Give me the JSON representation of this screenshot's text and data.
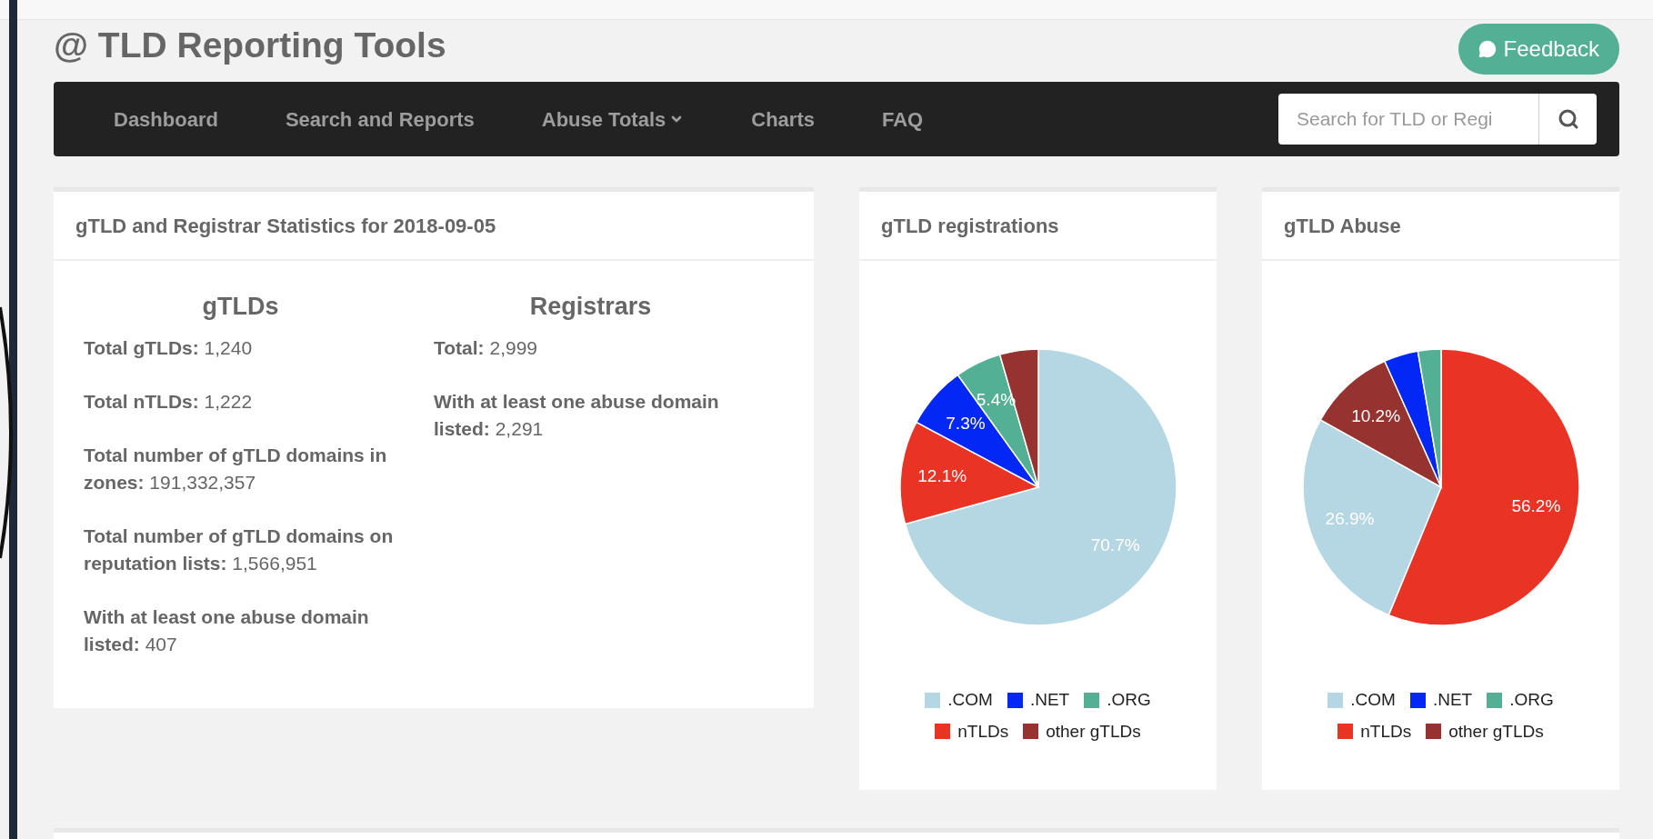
{
  "header": {
    "title": "@ TLD Reporting Tools",
    "feedback_button": "Feedback"
  },
  "nav": {
    "items": [
      {
        "label": "Dashboard",
        "dropdown": false
      },
      {
        "label": "Search and Reports",
        "dropdown": false
      },
      {
        "label": "Abuse Totals",
        "dropdown": true
      },
      {
        "label": "Charts",
        "dropdown": false
      },
      {
        "label": "FAQ",
        "dropdown": false
      }
    ],
    "search": {
      "placeholder": "Search for TLD or Regi"
    }
  },
  "stats_card": {
    "title": "gTLD and Registrar Statistics for 2018-09-05",
    "columns": [
      {
        "heading": "gTLDs",
        "items": [
          {
            "label": "Total gTLDs:",
            "value": "1,240"
          },
          {
            "label": "Total nTLDs:",
            "value": "1,222"
          },
          {
            "label": "Total number of gTLD domains in zones:",
            "value": "191,332,357"
          },
          {
            "label": "Total number of gTLD domains on reputation lists:",
            "value": "1,566,951"
          },
          {
            "label": "With at least one abuse domain listed:",
            "value": "407"
          }
        ]
      },
      {
        "heading": "Registrars",
        "items": [
          {
            "label": "Total:",
            "value": "2,999"
          },
          {
            "label": "With at least one abuse domain listed:",
            "value": "2,291"
          }
        ]
      }
    ]
  },
  "charts": [
    {
      "title": "gTLD registrations",
      "chart_data": {
        "type": "pie",
        "categories": [
          ".COM",
          ".NET",
          ".ORG",
          "nTLDs",
          "other gTLDs"
        ],
        "series": [
          {
            "colors": [
              "#b5d7e3",
              "#0328f5",
              "#53b095",
              "#e93324",
              "#963330"
            ],
            "values": [
              70.7,
              7.3,
              5.4,
              12.1,
              4.5
            ]
          }
        ],
        "value_labels": [
          "70.7%",
          "7.3%",
          "5.4%",
          "12.1%",
          null
        ]
      }
    },
    {
      "title": "gTLD Abuse",
      "chart_data": {
        "type": "pie",
        "categories": [
          ".COM",
          ".NET",
          ".ORG",
          "nTLDs",
          "other gTLDs"
        ],
        "series": [
          {
            "colors": [
              "#b5d7e3",
              "#0328f5",
              "#53b095",
              "#e93324",
              "#963330"
            ],
            "values": [
              26.9,
              4.0,
              2.7,
              56.2,
              10.2
            ]
          }
        ],
        "value_labels": [
          "26.9%",
          null,
          null,
          "56.2%",
          "10.2%"
        ]
      }
    }
  ]
}
